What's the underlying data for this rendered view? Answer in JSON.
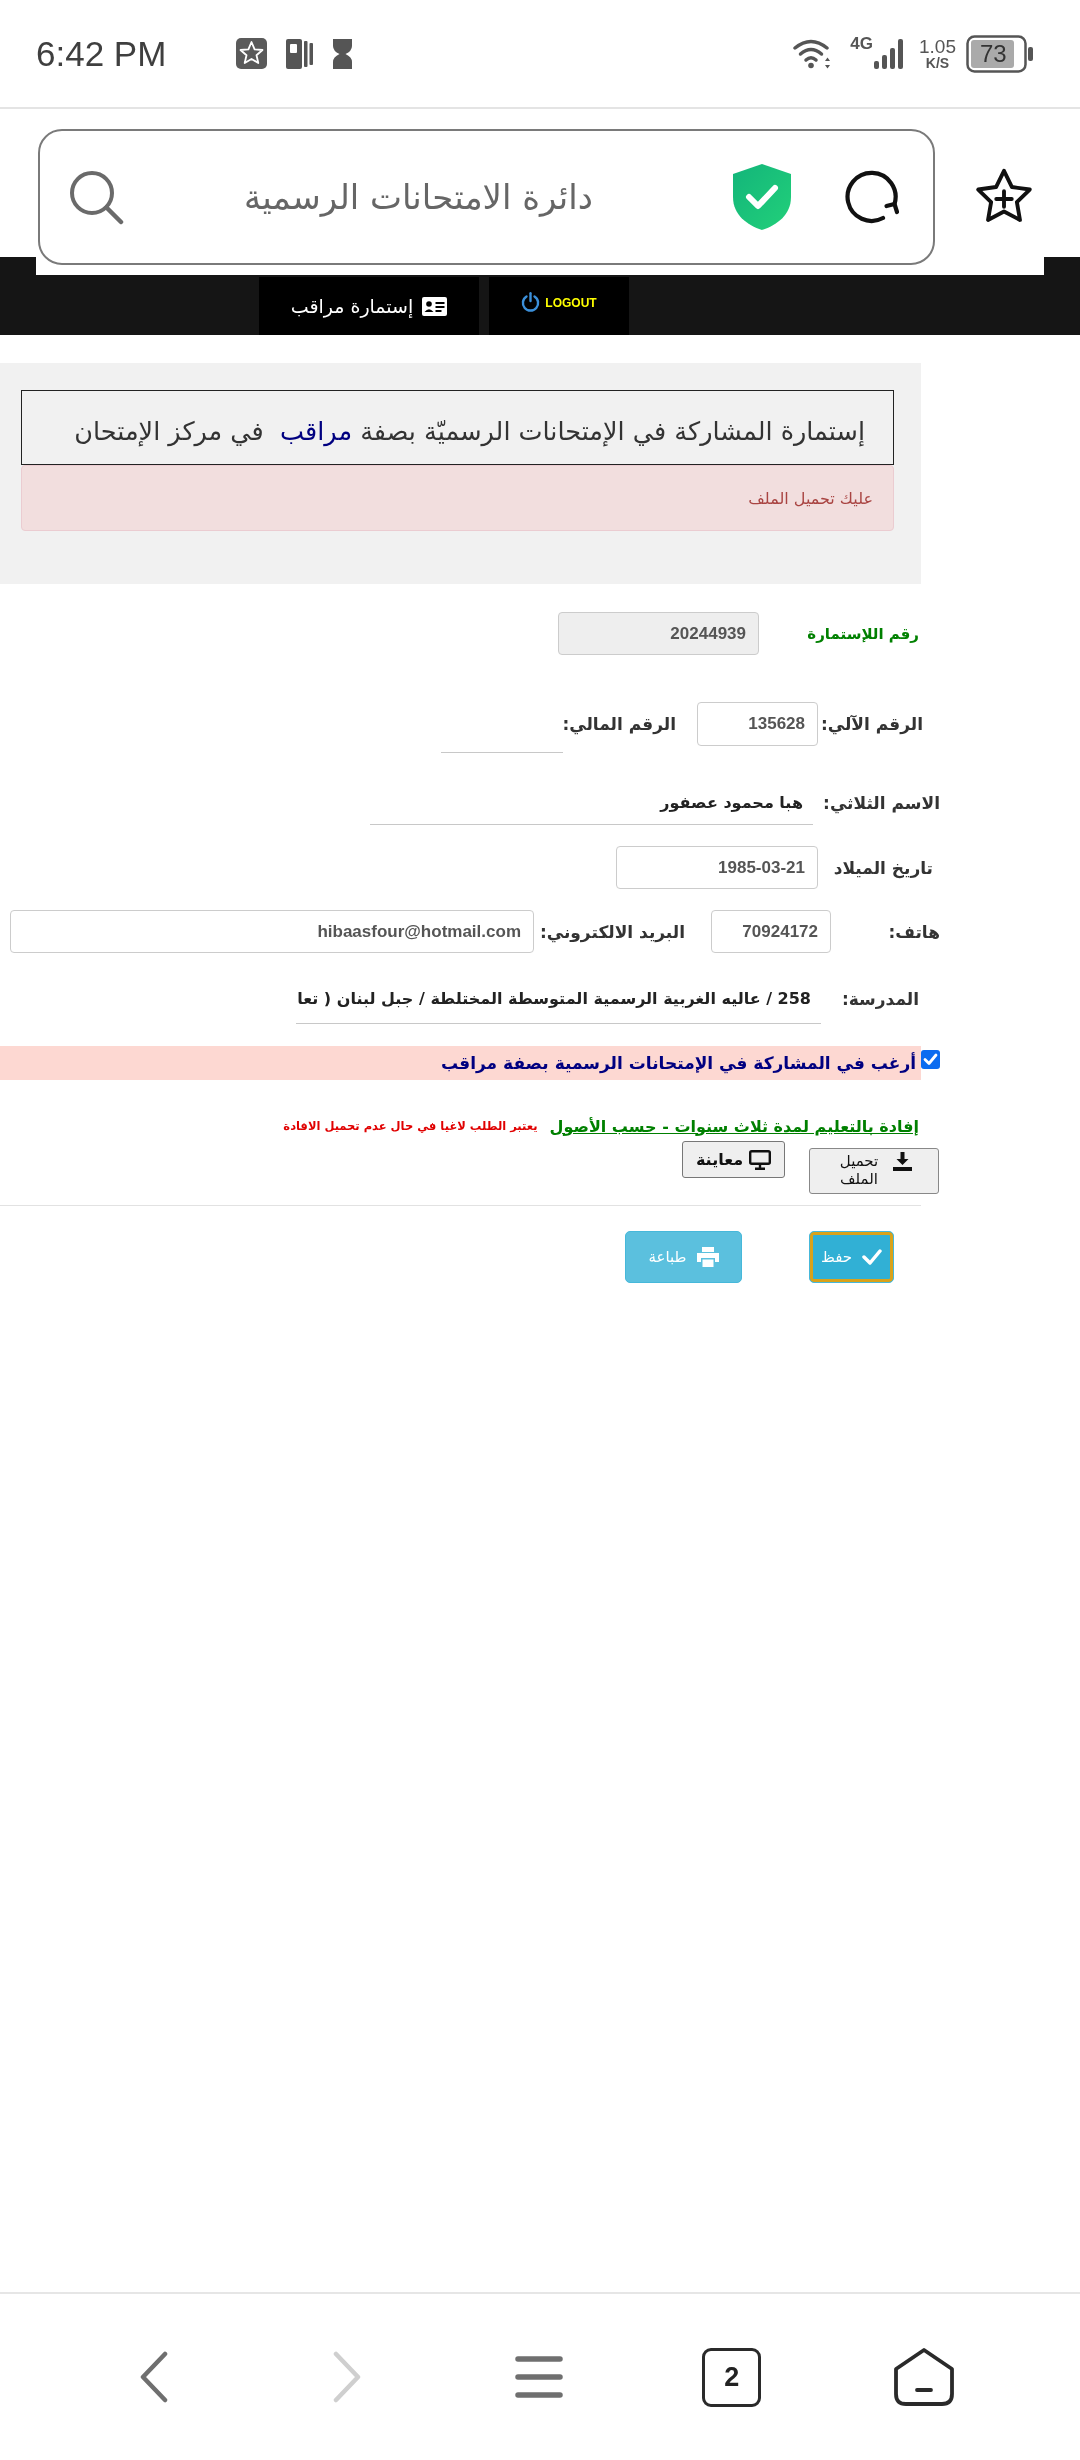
{
  "status_bar": {
    "time": "6:42 PM",
    "network": "4G",
    "speed": "1.05",
    "speed_unit": "K/S",
    "battery": "73"
  },
  "browser": {
    "page_title": "دائرة الامتحانات الرسمية"
  },
  "site_nav": [
    {
      "kind": "logout",
      "label": "LOGOUT"
    },
    {
      "kind": "form",
      "label": "إستمارة مراقب"
    }
  ],
  "form_header": {
    "title_parts": [
      {
        "text": "إستمارة المشاركة في الإمتحانات الرسميّة بصفة ",
        "highlighted": false
      },
      {
        "text": "مراقب",
        "highlighted": true
      },
      {
        "text": "  في مركز الإمتحان",
        "highlighted": false
      }
    ],
    "alert": "عليك تحميل الملف"
  },
  "form": {
    "rows": [
      {
        "fields": [
          {
            "kind": "readonly",
            "label": "رقم اللإستمارة",
            "value": "20244939"
          }
        ]
      },
      {
        "fields": [
          {
            "kind": "boxed",
            "label": "الرقم الآلي:",
            "value": "135628"
          },
          {
            "kind": "underlined",
            "label": "الرقم المالي:"
          }
        ]
      },
      {
        "fields": [
          {
            "kind": "underlined",
            "label": "الاسم الثلاثي:",
            "value": "هبا محمود عصفور"
          }
        ]
      },
      {
        "fields": [
          {
            "kind": "boxed",
            "label": "تاريخ الميلاد",
            "value": "1985-03-21"
          }
        ]
      },
      {
        "fields": [
          {
            "kind": "boxed",
            "label": "هاتف:",
            "value": "70924172"
          },
          {
            "kind": "boxed",
            "label": "البريد الالكتروني:",
            "value": "hibaasfour@hotmail.com"
          }
        ]
      },
      {
        "fields": [
          {
            "kind": "underlined",
            "label": "المدرسة:",
            "value": "258 / عاليه الغربية الرسمية المتوسطة المختلطة / جبل لبنان ( تعا"
          }
        ]
      }
    ],
    "consent": {
      "label": "أرغب في المشاركة في الإمتحانات الرسمية بصفة مراقب",
      "checked": true
    },
    "attachment": {
      "link": "إفادة بالتعليم لمدة ثلاث سنوات - حسب الأصول",
      "note": "يعتبر الطلب لاغيا في حال عدم تحميل الافادة",
      "upload_button": "تحميل الملف",
      "preview_button": "معاينة"
    }
  },
  "actions": [
    {
      "kind": "save",
      "label": "حفظ",
      "focused": true
    },
    {
      "kind": "print",
      "label": "طباعة",
      "focused": false
    }
  ],
  "bottom_nav": [
    {
      "kind": "back",
      "disabled": false
    },
    {
      "kind": "forward",
      "disabled": true
    },
    {
      "kind": "menu",
      "disabled": false
    },
    {
      "kind": "tabs",
      "count": "2",
      "disabled": false
    },
    {
      "kind": "home",
      "disabled": false
    }
  ]
}
